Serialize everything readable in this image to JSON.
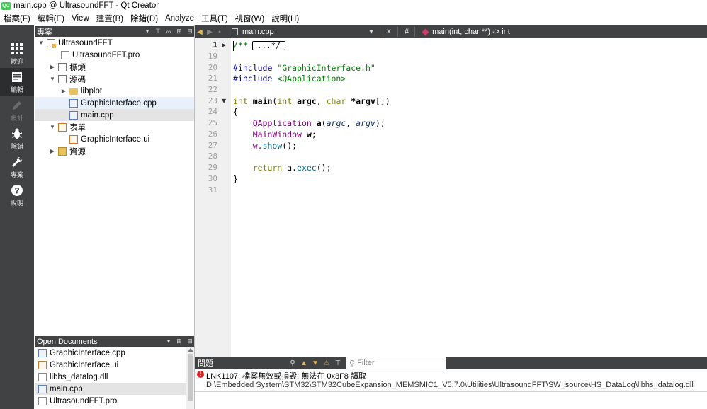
{
  "window": {
    "title": "main.cpp @ UltrasoundFFT - Qt Creator",
    "app_icon_text": "QC"
  },
  "menubar": [
    "檔案(F)",
    "編輯(E)",
    "View",
    "建置(B)",
    "除錯(D)",
    "Analyze",
    "工具(T)",
    "視窗(W)",
    "說明(H)"
  ],
  "modes": [
    {
      "label": "歡迎",
      "icon": "grid-icon",
      "active": false,
      "disabled": false
    },
    {
      "label": "編輯",
      "icon": "edit-icon",
      "active": true,
      "disabled": false
    },
    {
      "label": "設計",
      "icon": "pencil-icon",
      "active": false,
      "disabled": true
    },
    {
      "label": "除錯",
      "icon": "bug-icon",
      "active": false,
      "disabled": false
    },
    {
      "label": "專案",
      "icon": "wrench-icon",
      "active": false,
      "disabled": false
    },
    {
      "label": "說明",
      "icon": "help-icon",
      "active": false,
      "disabled": false
    }
  ],
  "project_panel": {
    "title": "專案",
    "tree": [
      {
        "label": "UltrasoundFFT",
        "arrow": "expanded",
        "icon": "project-icon",
        "indent": 0
      },
      {
        "label": "UltrasoundFFT.pro",
        "arrow": "none",
        "icon": "pro-file-icon",
        "indent": 1
      },
      {
        "label": "標頭",
        "arrow": "collapsed",
        "icon": "headers-folder-icon",
        "indent": 1
      },
      {
        "label": "源碼",
        "arrow": "expanded",
        "icon": "sources-folder-icon",
        "indent": 1
      },
      {
        "label": "libplot",
        "arrow": "collapsed",
        "icon": "folder-icon",
        "indent": 2
      },
      {
        "label": "GraphicInterface.cpp",
        "arrow": "none",
        "icon": "cpp-file-icon",
        "indent": 2,
        "state": "hover"
      },
      {
        "label": "main.cpp",
        "arrow": "none",
        "icon": "cpp-file-icon",
        "indent": 2,
        "state": "selected"
      },
      {
        "label": "表單",
        "arrow": "expanded",
        "icon": "forms-folder-icon",
        "indent": 1
      },
      {
        "label": "GraphicInterface.ui",
        "arrow": "none",
        "icon": "ui-file-icon",
        "indent": 2
      },
      {
        "label": "資源",
        "arrow": "collapsed",
        "icon": "resources-folder-icon",
        "indent": 1
      }
    ]
  },
  "open_documents": {
    "title": "Open Documents",
    "items": [
      {
        "label": "GraphicInterface.cpp",
        "icon": "cpp-file-icon",
        "selected": false
      },
      {
        "label": "GraphicInterface.ui",
        "icon": "ui-file-icon",
        "selected": false
      },
      {
        "label": "libhs_datalog.dll",
        "icon": "file-icon",
        "selected": false
      },
      {
        "label": "main.cpp",
        "icon": "cpp-file-icon",
        "selected": true
      },
      {
        "label": "UltrasoundFFT.pro",
        "icon": "pro-file-icon",
        "selected": false
      }
    ]
  },
  "editor_toolbar": {
    "file": "main.cpp",
    "hash": "#",
    "symbol": "main(int, char **) -> int"
  },
  "editor": {
    "current_line": 1,
    "lines": [
      {
        "n": "1",
        "fold": "collapsed"
      },
      {
        "n": "19"
      },
      {
        "n": "20"
      },
      {
        "n": "21"
      },
      {
        "n": "22"
      },
      {
        "n": "23",
        "fold": "expanded"
      },
      {
        "n": "24"
      },
      {
        "n": "25"
      },
      {
        "n": "26"
      },
      {
        "n": "27"
      },
      {
        "n": "28"
      },
      {
        "n": "29"
      },
      {
        "n": "30"
      },
      {
        "n": "31"
      }
    ],
    "code": {
      "l1_comment": "/**",
      "l1_collapsed": "...*/",
      "l20_directive": "#include",
      "l20_arg": " \"GraphicInterface.h\"",
      "l21_directive": "#include",
      "l21_arg": " <QApplication>",
      "l23_type": "int",
      "l23_name": "main",
      "l23_p1": "(",
      "l23_int": "int",
      "l23_argc": " argc",
      "l23_comma": ", ",
      "l23_char": "char",
      "l23_argv": " *argv",
      "l23_end": "[])",
      "l24": "{",
      "l25_type": "QApplication",
      "l25_var": " a",
      "l25_open": "(",
      "l25_argc": "argc",
      "l25_comma": ", ",
      "l25_argv": "argv",
      "l25_close": ");",
      "l26_type": "MainWindow",
      "l26_var": " w",
      "l26_semi": ";",
      "l27_obj": "w.",
      "l27_fn": "show",
      "l27_rest": "();",
      "l29_kw": "return",
      "l29_obj": " a.",
      "l29_fn": "exec",
      "l29_rest": "();",
      "l30": "}"
    }
  },
  "issues": {
    "title": "問題",
    "filter_placeholder": "Filter",
    "items": [
      {
        "severity": "error",
        "message": "LNK1107: 檔案無效或損毀: 無法在 0x3F8 讀取",
        "path": "D:\\Embedded System\\STM32\\STM32CubeExpansion_MEMSMIC1_V5.7.0\\Utilities\\UltrasoundFFT\\SW_source\\HS_DataLog\\libhs_datalog.dll"
      }
    ]
  },
  "colors": {
    "dark_panel": "#404244",
    "keyword": "#808000",
    "preprocessor": "#000080",
    "string": "#008000",
    "type": "#800080",
    "error": "#dd2222"
  }
}
